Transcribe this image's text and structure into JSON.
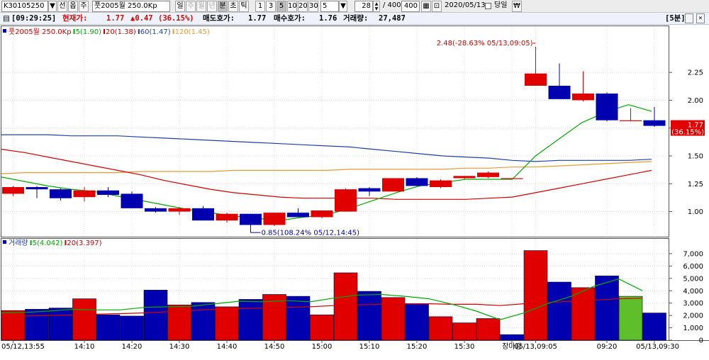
{
  "toolbar": {
    "code": "K30105250",
    "icon1": "선",
    "icon2": "옵",
    "icon3": "주",
    "item_name": "풋2005월 250.0Kp",
    "periods": [
      "일",
      "주",
      "월",
      "년",
      "분",
      "초",
      "틱"
    ],
    "active_period": "분",
    "intervals": [
      "1",
      "3",
      "5",
      "10",
      "20",
      "30"
    ],
    "active_interval": "5",
    "interval_select": "5",
    "count": "28",
    "slash_total": "/ 400",
    "total": "400",
    "date": "2020/05/13",
    "checkbox_label": "당일",
    "won_icon": "₩"
  },
  "infobar": {
    "time": "[09:29:25]",
    "current_label": "현재가:",
    "current_value": "1.77",
    "change": "▲0.47",
    "change_pct": "(36.15%)",
    "ask_label": "매도호가:",
    "ask_value": "1.77",
    "bid_label": "매수호가:",
    "bid_value": "1.76",
    "volume_label": "거래량:",
    "volume_value": "27,487",
    "interval_tag": "[5분]"
  },
  "chart_data": [
    {
      "type": "candlestick",
      "legend": [
        {
          "label": "풋2005월 250.0Kp",
          "color": "#d40000"
        },
        {
          "label": "5(1.90)",
          "color": "#00aa00"
        },
        {
          "label": "20(1.38)",
          "color": "#d40000"
        },
        {
          "label": "60(1.47)",
          "color": "#1f3fb0"
        },
        {
          "label": "120(1.45)",
          "color": "#e89a30"
        }
      ],
      "ylim": [
        0.8,
        2.55
      ],
      "yticks": [
        "2.25",
        "2.00",
        "1.75",
        "1.50",
        "1.25",
        "1.00"
      ],
      "ytick_values": [
        2.25,
        2.0,
        1.75,
        1.5,
        1.25,
        1.0
      ],
      "candles": [
        {
          "o": 1.16,
          "h": 1.23,
          "l": 1.14,
          "c": 1.22
        },
        {
          "o": 1.22,
          "h": 1.23,
          "l": 1.12,
          "c": 1.2
        },
        {
          "o": 1.2,
          "h": 1.21,
          "l": 1.1,
          "c": 1.12
        },
        {
          "o": 1.13,
          "h": 1.22,
          "l": 1.09,
          "c": 1.19
        },
        {
          "o": 1.19,
          "h": 1.22,
          "l": 1.13,
          "c": 1.15
        },
        {
          "o": 1.16,
          "h": 1.18,
          "l": 1.03,
          "c": 1.03
        },
        {
          "o": 1.03,
          "h": 1.04,
          "l": 0.99,
          "c": 1.0
        },
        {
          "o": 1.0,
          "h": 1.04,
          "l": 0.97,
          "c": 1.03
        },
        {
          "o": 1.03,
          "h": 1.05,
          "l": 0.92,
          "c": 0.92
        },
        {
          "o": 0.92,
          "h": 0.99,
          "l": 0.9,
          "c": 0.98
        },
        {
          "o": 0.98,
          "h": 0.98,
          "l": 0.85,
          "c": 0.88
        },
        {
          "o": 0.88,
          "h": 0.99,
          "l": 0.87,
          "c": 0.99
        },
        {
          "o": 0.99,
          "h": 1.03,
          "l": 0.95,
          "c": 0.95
        },
        {
          "o": 0.95,
          "h": 1.01,
          "l": 0.94,
          "c": 1.01
        },
        {
          "o": 1.0,
          "h": 1.21,
          "l": 1.0,
          "c": 1.2
        },
        {
          "o": 1.21,
          "h": 1.22,
          "l": 1.14,
          "c": 1.18
        },
        {
          "o": 1.18,
          "h": 1.3,
          "l": 1.18,
          "c": 1.3
        },
        {
          "o": 1.3,
          "h": 1.31,
          "l": 1.23,
          "c": 1.23
        },
        {
          "o": 1.22,
          "h": 1.29,
          "l": 1.21,
          "c": 1.28
        },
        {
          "o": 1.3,
          "h": 1.32,
          "l": 1.29,
          "c": 1.32
        },
        {
          "o": 1.31,
          "h": 1.36,
          "l": 1.3,
          "c": 1.35
        },
        {
          "o": 1.3,
          "h": 1.3,
          "l": 1.3,
          "c": 1.3
        },
        {
          "o": 2.13,
          "h": 2.48,
          "l": 2.13,
          "c": 2.24
        },
        {
          "o": 2.13,
          "h": 2.33,
          "l": 2.01,
          "c": 2.01
        },
        {
          "o": 2.0,
          "h": 2.26,
          "l": 1.99,
          "c": 2.06
        },
        {
          "o": 2.06,
          "h": 2.07,
          "l": 1.81,
          "c": 1.82
        },
        {
          "o": 1.82,
          "h": 1.93,
          "l": 1.81,
          "c": 1.82
        },
        {
          "o": 1.82,
          "h": 1.94,
          "l": 1.76,
          "c": 1.77
        }
      ],
      "ma5": [
        1.31,
        1.27,
        1.23,
        1.2,
        1.18,
        1.14,
        1.1,
        1.06,
        1.02,
        0.99,
        0.96,
        0.94,
        0.92,
        0.95,
        0.97,
        1.03,
        1.1,
        1.17,
        1.23,
        1.26,
        1.29,
        1.29,
        1.29,
        1.5,
        1.65,
        1.8,
        1.89,
        1.96,
        1.9
      ],
      "ma20": [
        1.56,
        1.53,
        1.49,
        1.45,
        1.41,
        1.37,
        1.33,
        1.28,
        1.24,
        1.2,
        1.17,
        1.15,
        1.13,
        1.12,
        1.12,
        1.12,
        1.12,
        1.11,
        1.11,
        1.11,
        1.11,
        1.12,
        1.13,
        1.17,
        1.21,
        1.25,
        1.29,
        1.33,
        1.37
      ],
      "ma60": [
        1.69,
        1.69,
        1.69,
        1.68,
        1.68,
        1.68,
        1.67,
        1.66,
        1.65,
        1.64,
        1.63,
        1.62,
        1.61,
        1.6,
        1.59,
        1.58,
        1.56,
        1.54,
        1.52,
        1.5,
        1.49,
        1.48,
        1.46,
        1.45,
        1.46,
        1.46,
        1.46,
        1.46,
        1.47
      ],
      "ma120": [
        1.34,
        1.35,
        1.35,
        1.35,
        1.35,
        1.35,
        1.36,
        1.36,
        1.36,
        1.36,
        1.37,
        1.37,
        1.37,
        1.37,
        1.37,
        1.38,
        1.38,
        1.38,
        1.38,
        1.38,
        1.39,
        1.39,
        1.4,
        1.4,
        1.41,
        1.42,
        1.43,
        1.44,
        1.45
      ],
      "current_price": {
        "value": "1.77",
        "pct": "(36.15%)"
      },
      "high_annotation": "2.48(-28.63% 05/13,09:05)",
      "low_annotation": "0.85(108.24% 05/12,14:45)"
    },
    {
      "type": "bar",
      "legend": [
        {
          "label": "거래량",
          "color": "#1f3fb0"
        },
        {
          "label": "5(4.042)",
          "color": "#00aa00"
        },
        {
          "label": "20(3.397)",
          "color": "#d40000"
        }
      ],
      "ylim": [
        0,
        7800
      ],
      "yticks": [
        "7,000",
        "6,000",
        "5,000",
        "4,000",
        "3,000",
        "2,000",
        "1,000",
        "0"
      ],
      "ytick_values": [
        7000,
        6000,
        5000,
        4000,
        3000,
        2000,
        1000,
        0
      ],
      "values": [
        2400,
        2500,
        2600,
        3350,
        2050,
        1950,
        4050,
        2850,
        3050,
        2700,
        3300,
        3700,
        3550,
        2050,
        5450,
        3950,
        3450,
        2950,
        1900,
        1400,
        1750,
        450,
        7250,
        4700,
        4250,
        5200,
        3550,
        2200
      ],
      "colors": [
        "red",
        "blue",
        "blue",
        "red",
        "blue",
        "blue",
        "blue",
        "red",
        "blue",
        "red",
        "blue",
        "red",
        "blue",
        "red",
        "red",
        "blue",
        "red",
        "blue",
        "red",
        "red",
        "red",
        "blue",
        "red",
        "blue",
        "red",
        "blue",
        "green",
        "blue"
      ],
      "ma5": [
        2200,
        2250,
        2350,
        2500,
        2450,
        2450,
        2650,
        2700,
        2750,
        2950,
        3150,
        3100,
        3200,
        3100,
        3400,
        3650,
        3700,
        3550,
        3350,
        2900,
        2350,
        1650,
        2200,
        2950,
        3550,
        4400,
        4950,
        4000
      ],
      "ma20": [
        1900,
        1950,
        2000,
        2050,
        2100,
        2150,
        2200,
        2300,
        2400,
        2500,
        2550,
        2600,
        2650,
        2700,
        2800,
        2850,
        2900,
        2950,
        2950,
        2900,
        2900,
        2800,
        2950,
        3050,
        3150,
        3250,
        3350,
        3400
      ],
      "xlabels": [
        {
          "i": 0,
          "text": "05/12,13:55"
        },
        {
          "i": 3,
          "text": "14:10"
        },
        {
          "i": 5,
          "text": "14:20"
        },
        {
          "i": 7,
          "text": "14:30"
        },
        {
          "i": 9,
          "text": "14:40"
        },
        {
          "i": 11,
          "text": "14:50"
        },
        {
          "i": 13,
          "text": "15:00"
        },
        {
          "i": 15,
          "text": "15:10"
        },
        {
          "i": 17,
          "text": "15:20"
        },
        {
          "i": 19,
          "text": "15:30"
        },
        {
          "i": 21,
          "text": "장마감"
        },
        {
          "i": 22,
          "text": "05/13,09:05"
        },
        {
          "i": 25,
          "text": "09:20"
        },
        {
          "i": 27,
          "text": "05/13,09:30"
        }
      ]
    }
  ]
}
